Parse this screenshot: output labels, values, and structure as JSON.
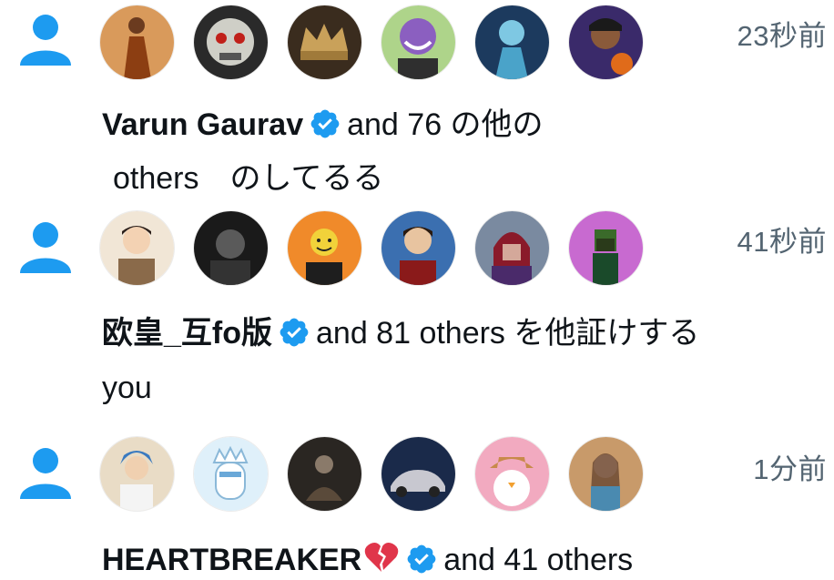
{
  "colors": {
    "accent": "#1d9bf0",
    "muted": "#536471",
    "text": "#0f1419"
  },
  "notifications": [
    {
      "time": "23秒前",
      "avatars": [
        "monk-avatar",
        "skull-avatar",
        "crown-avatar",
        "troll-avatar",
        "cyber-avatar",
        "anime-boy-avatar"
      ],
      "user": "Varun Gaurav",
      "line1_rest": "and 76 の他の",
      "line2": "others　のしてるる"
    },
    {
      "time": "41秒前",
      "avatars": [
        "soldier-avatar",
        "dark-photo-avatar",
        "smiley-avatar",
        "anime-man-avatar",
        "magneto-avatar",
        "pixel-avatar"
      ],
      "user": "欧皇_互fo版",
      "line1_rest": "and 81 others を他証けする",
      "line2": "you"
    },
    {
      "time": "1分前",
      "avatars": [
        "doctor-avatar",
        "penguin-crown-avatar",
        "meditate-avatar",
        "car-avatar",
        "cowboy-penguin-avatar",
        "woman-avatar"
      ],
      "user": "HEARTBREAKER",
      "user_emoji": "broken-heart-icon",
      "line1_rest": "and 41 others"
    }
  ]
}
